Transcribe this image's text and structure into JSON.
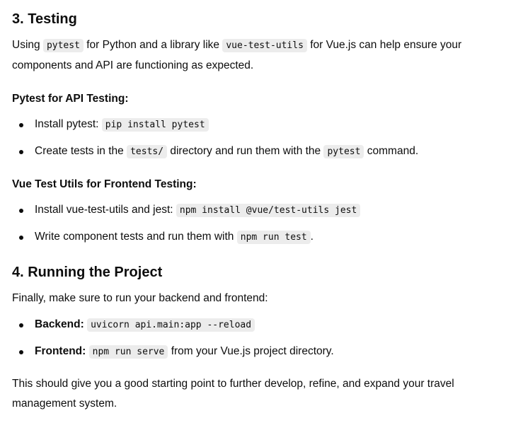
{
  "s3": {
    "heading": "3. Testing",
    "intro": {
      "a": "Using ",
      "c1": "pytest",
      "b": " for Python and a library like ",
      "c2": "vue-test-utils",
      "c": " for Vue.js can help ensure your components and API are functioning as expected."
    },
    "pytest_heading": "Pytest for API Testing:",
    "pytest_items": [
      {
        "a": "Install pytest: ",
        "c1": "pip install pytest"
      },
      {
        "a": "Create tests in the ",
        "c1": "tests/",
        "b": " directory and run them with the ",
        "c2": "pytest",
        "c": " command."
      }
    ],
    "vue_heading": "Vue Test Utils for Frontend Testing:",
    "vue_items": [
      {
        "a": "Install vue-test-utils and jest: ",
        "c1": "npm install @vue/test-utils jest"
      },
      {
        "a": "Write component tests and run them with ",
        "c1": "npm run test",
        "b": "."
      }
    ]
  },
  "s4": {
    "heading": "4. Running the Project",
    "intro": "Finally, make sure to run your backend and frontend:",
    "items": [
      {
        "label": "Backend:",
        "c1": "uvicorn api.main:app --reload",
        "b": ""
      },
      {
        "label": "Frontend:",
        "c1": "npm run serve",
        "b": " from your Vue.js project directory."
      }
    ],
    "closing": "This should give you a good starting point to further develop, refine, and expand your travel management system."
  }
}
